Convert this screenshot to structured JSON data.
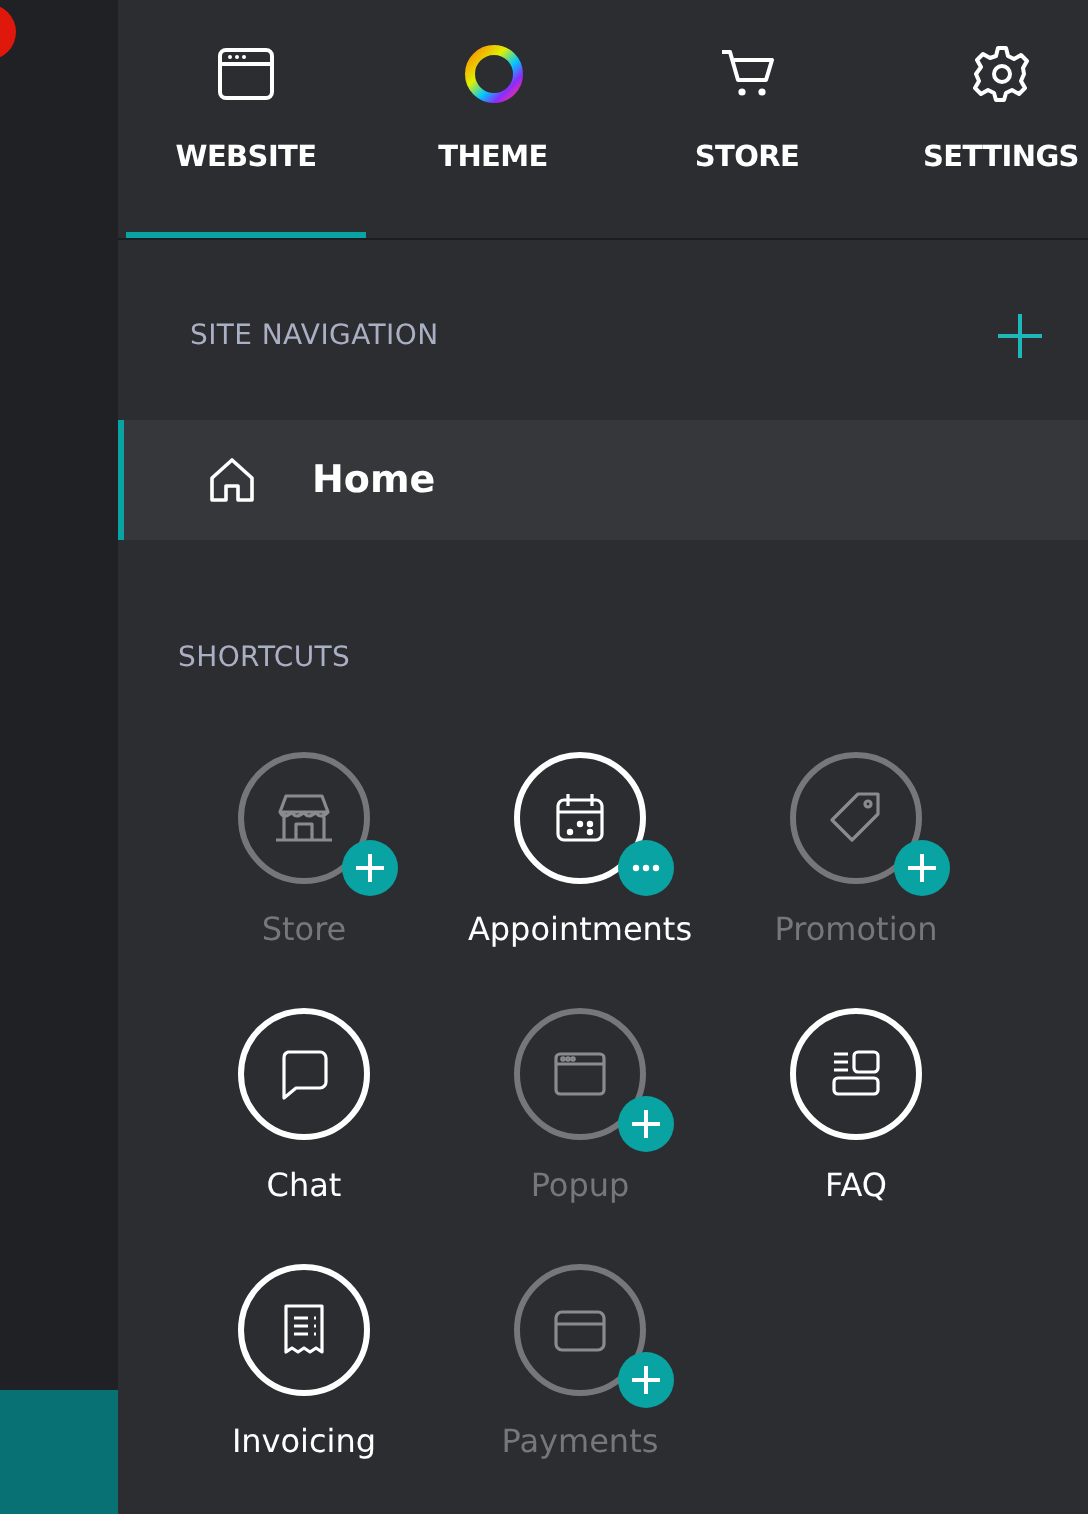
{
  "tabs": [
    {
      "label": "WEBSITE",
      "selected": true
    },
    {
      "label": "THEME",
      "selected": false
    },
    {
      "label": "STORE",
      "selected": false
    },
    {
      "label": "SETTINGS",
      "selected": false
    }
  ],
  "site_navigation": {
    "title": "SITE NAVIGATION",
    "pages": [
      {
        "label": "Home",
        "selected": true
      }
    ]
  },
  "shortcuts": {
    "title": "SHORTCUTS",
    "items": [
      {
        "label": "Store",
        "kind": "available"
      },
      {
        "label": "Appointments",
        "kind": "configurable"
      },
      {
        "label": "Promotion",
        "kind": "available"
      },
      {
        "label": "Chat",
        "kind": "added"
      },
      {
        "label": "Popup",
        "kind": "available"
      },
      {
        "label": "FAQ",
        "kind": "added"
      },
      {
        "label": "Invoicing",
        "kind": "added"
      },
      {
        "label": "Payments",
        "kind": "available"
      }
    ]
  }
}
